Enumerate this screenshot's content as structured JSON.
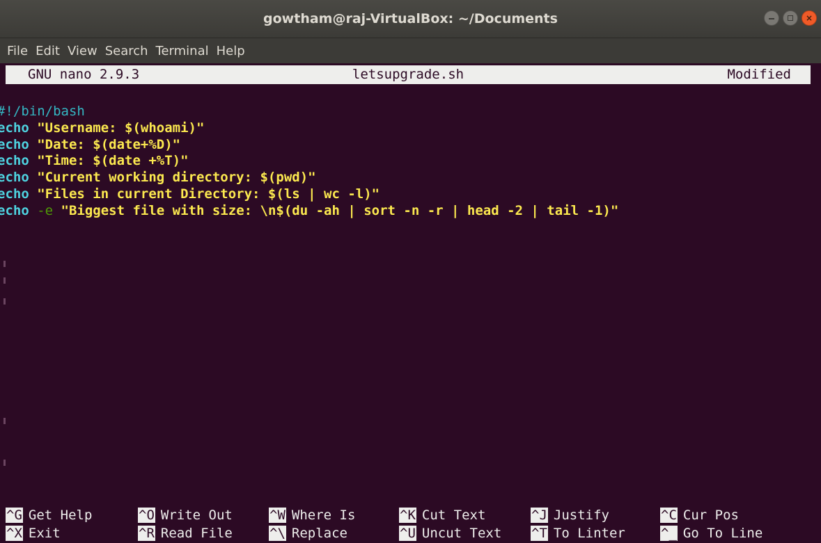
{
  "window": {
    "title": "gowtham@raj-VirtualBox: ~/Documents",
    "controls": {
      "minimize": "–",
      "maximize": "□",
      "close": "×"
    }
  },
  "menubar": {
    "items": [
      {
        "label": "File"
      },
      {
        "label": "Edit"
      },
      {
        "label": "View"
      },
      {
        "label": "Search"
      },
      {
        "label": "Terminal"
      },
      {
        "label": "Help"
      }
    ]
  },
  "nano": {
    "version": "GNU nano 2.9.3",
    "filename": "letsupgrade.sh",
    "status": "Modified"
  },
  "editor": {
    "lines": [
      [
        {
          "cls": "tok-comment",
          "text": "#!/bin/bash"
        }
      ],
      [
        {
          "cls": "tok-kw",
          "text": "echo"
        },
        {
          "cls": "tok-str",
          "text": " \"Username: $(whoami)\""
        }
      ],
      [
        {
          "cls": "tok-kw",
          "text": "echo"
        },
        {
          "cls": "tok-str",
          "text": " \"Date: $(date+%D)\""
        }
      ],
      [
        {
          "cls": "tok-kw",
          "text": "echo"
        },
        {
          "cls": "tok-str",
          "text": " \"Time: $(date +%T)\""
        }
      ],
      [
        {
          "cls": "tok-kw",
          "text": "echo"
        },
        {
          "cls": "tok-str",
          "text": " \"Current working directory: $(pwd)\""
        }
      ],
      [
        {
          "cls": "tok-kw",
          "text": "echo"
        },
        {
          "cls": "tok-str",
          "text": " \"Files in current Directory: $(ls | wc -l)\""
        }
      ],
      [
        {
          "cls": "tok-kw",
          "text": "echo"
        },
        {
          "cls": "tok-flag",
          "text": " -e"
        },
        {
          "cls": "tok-str",
          "text": " \"Biggest file with size: \\n$(du -ah | sort -n -r | head -2 | tail -1)\""
        }
      ]
    ]
  },
  "shortcuts": {
    "row1": [
      {
        "key": "^G",
        "label": "Get Help"
      },
      {
        "key": "^O",
        "label": "Write Out"
      },
      {
        "key": "^W",
        "label": "Where Is"
      },
      {
        "key": "^K",
        "label": "Cut Text"
      },
      {
        "key": "^J",
        "label": "Justify"
      },
      {
        "key": "^C",
        "label": "Cur Pos"
      }
    ],
    "row2": [
      {
        "key": "^X",
        "label": "Exit"
      },
      {
        "key": "^R",
        "label": "Read File"
      },
      {
        "key": "^\\",
        "label": "Replace"
      },
      {
        "key": "^U",
        "label": "Uncut Text"
      },
      {
        "key": "^T",
        "label": "To Linter"
      },
      {
        "key": "^_",
        "label": "Go To Line"
      }
    ]
  },
  "colors": {
    "terminal_bg": "#2c0a24",
    "titlebar_bg": "#3c3b37",
    "string": "#fce94f",
    "keyword": "#4ed3e0",
    "flag": "#4e9a06",
    "close_button": "#f05a28"
  }
}
